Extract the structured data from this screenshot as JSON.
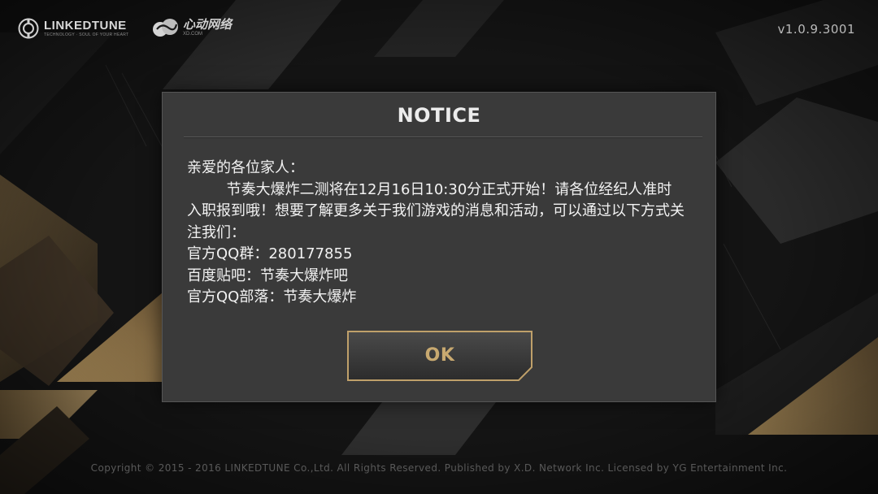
{
  "header": {
    "brand": {
      "name": "LINKEDTUNE",
      "tagline": "TECHNOLOGY · SOUL OF YOUR HEART"
    },
    "publisher": {
      "name": "心动网络",
      "domain": "XD.COM"
    },
    "version": "v1.0.9.3001"
  },
  "dialog": {
    "title": "NOTICE",
    "message": {
      "greeting": "亲爱的各位家人：",
      "body": "节奏大爆炸二测将在12月16日10:30分正式开始！请各位经纪人准时入职报到哦！想要了解更多关于我们游戏的消息和活动，可以通过以下方式关注我们：",
      "qq_group": "官方QQ群：280177855",
      "baidu_tieba": "百度贴吧：节奏大爆炸吧",
      "qq_tribe": "官方QQ部落：节奏大爆炸"
    },
    "ok_label": "OK"
  },
  "footer": {
    "copyright": "Copyright © 2015 - 2016 LINKEDTUNE Co.,Ltd. All Rights Reserved. Published by X.D. Network Inc. Licensed by YG Entertainment Inc."
  },
  "colors": {
    "background": "#121212",
    "dialog_bg": "#3a3a3a",
    "gold_accent": "#bfa06a",
    "ok_text": "#c8a970"
  },
  "icons": {
    "brand_logo": "linkedtune-logo-icon",
    "publisher_logo": "xd-logo-icon"
  }
}
